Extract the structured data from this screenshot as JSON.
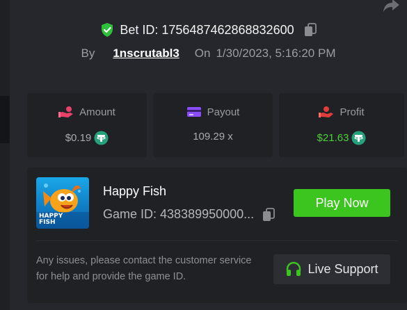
{
  "bet": {
    "label": "Bet ID: 1756487462868832600",
    "by_label": "By",
    "user": "1nscrutabl3",
    "on_label": "On",
    "date": "1/30/2023, 5:16:20 PM"
  },
  "stats": [
    {
      "label": "Amount",
      "value": "$0.19",
      "icon": "hand-coin-icon",
      "color": "#e8416a"
    },
    {
      "label": "Payout",
      "value": "109.29 x",
      "icon": "card-icon",
      "color": "#8c4bff"
    },
    {
      "label": "Profit",
      "value": "$21.63",
      "icon": "profit-icon",
      "color": "#e03c3c"
    }
  ],
  "game": {
    "name": "Happy Fish",
    "id": "Game ID: 438389950000...",
    "thumb_text": "HAPPY FISH",
    "play_label": "Play Now",
    "help_text": "Any issues, please contact the customer service for help and provide the game ID.",
    "support_label": "Live Support"
  },
  "colors": {
    "accent_green": "#3cc51f",
    "profit_green": "#4cd137",
    "tether_teal": "#26a17b",
    "panel_bg": "#26272c"
  }
}
